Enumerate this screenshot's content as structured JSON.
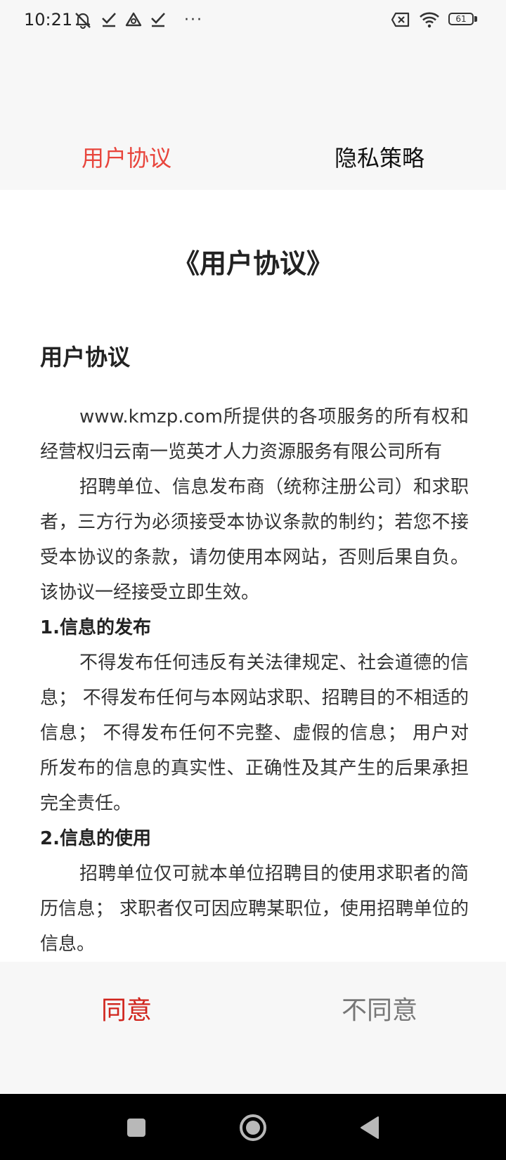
{
  "status_bar": {
    "time": "10:21",
    "more_indicator": "···",
    "battery_level": "61",
    "icons_left": [
      "alarm-off-icon",
      "check-icon",
      "triangle-app-icon",
      "check-icon"
    ],
    "icons_right": [
      "sim-x-icon",
      "wifi-icon",
      "battery-icon"
    ]
  },
  "tabs": [
    {
      "label": "用户协议",
      "active": true
    },
    {
      "label": "隐私策略",
      "active": false
    }
  ],
  "content": {
    "doc_title": "《用户协议》",
    "section_title": "用户协议",
    "paragraphs": {
      "p1": "www.kmzp.com所提供的各项服务的所有权和经营权归云南一览英才人力资源服务有限公司所有",
      "p2": "招聘单位、信息发布商（统称注册公司）和求职者，三方行为必须接受本协议条款的制约；若您不接受本协议的条款，请勿使用本网站，否则后果自负。该协议一经接受立即生效。",
      "h1": "1.信息的发布",
      "p3": "不得发布任何违反有关法律规定、社会道德的信息； 不得发布任何与本网站求职、招聘目的不相适的信息； 不得发布任何不完整、虚假的信息； 用户对所发布的信息的真实性、正确性及其产生的后果承担完全责任。",
      "h2": "2.信息的使用",
      "p4": "招聘单位仅可就本单位招聘目的使用求职者的简历信息； 求职者仅可因应聘某职位，使用招聘单位的信息。"
    }
  },
  "actions": {
    "agree_label": "同意",
    "disagree_label": "不同意"
  },
  "colors": {
    "active_tab": "#e8453c",
    "agree": "#d0241c",
    "disagree": "#777777"
  },
  "nav_bar": {
    "icons": [
      "recents-square-icon",
      "home-circle-icon",
      "back-triangle-icon"
    ]
  }
}
